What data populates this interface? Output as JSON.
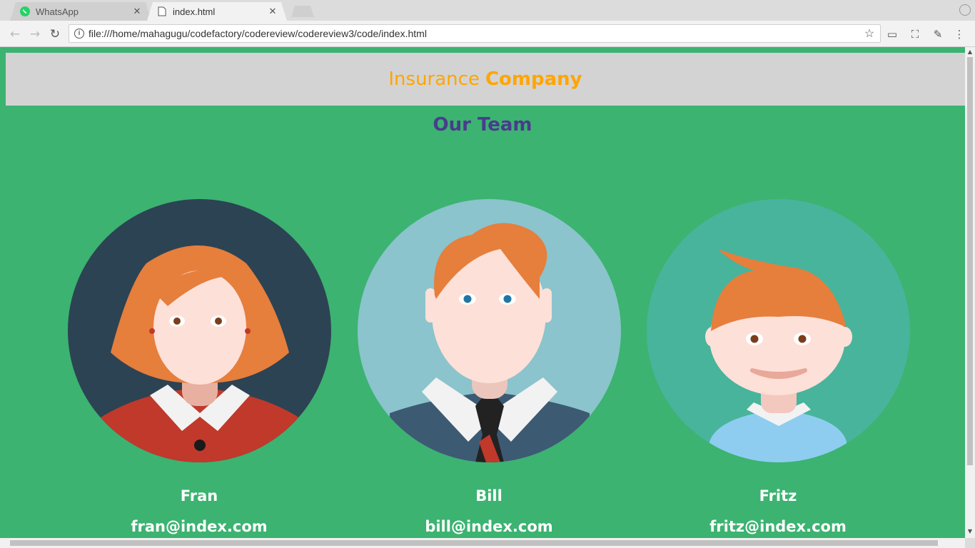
{
  "browser": {
    "tabs": [
      {
        "title": "WhatsApp",
        "active": false,
        "icon": "whatsapp-icon"
      },
      {
        "title": "index.html",
        "active": true,
        "icon": "document-icon"
      }
    ],
    "url": "file:///home/mahagugu/codefactory/codereview/codereview3/code/index.html"
  },
  "page": {
    "header": {
      "light": "Insurance",
      "bold": "Company"
    },
    "team_title": "Our Team",
    "members": [
      {
        "name": "Fran",
        "email": "fran@index.com",
        "bg": "#2c4353"
      },
      {
        "name": "Bill",
        "email": "bill@index.com",
        "bg": "#8bc4cc"
      },
      {
        "name": "Fritz",
        "email": "fritz@index.com",
        "bg": "#48b49c"
      }
    ]
  },
  "colors": {
    "page_bg": "#3cb371",
    "header_bg": "#d3d3d3",
    "header_text": "#ffa500",
    "team_title": "#483d8b"
  }
}
